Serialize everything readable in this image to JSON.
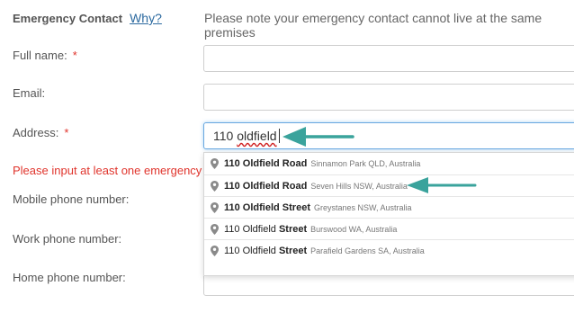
{
  "header": {
    "title": "Emergency Contact",
    "why_link": "Why?",
    "note": "Please note your emergency contact cannot live at the same premises"
  },
  "fields": {
    "full_name": {
      "label": "Full name:",
      "required": "*"
    },
    "email": {
      "label": "Email:"
    },
    "address": {
      "label": "Address:",
      "required": "*",
      "value_plain": "110 ",
      "value_spell": "oldfield"
    },
    "error": "Please input at least one emergency c",
    "mobile": {
      "label": "Mobile phone number:"
    },
    "work": {
      "label": "Work phone number:"
    },
    "home": {
      "label": "Home phone number:"
    }
  },
  "suggestions": [
    {
      "bold": "110 Oldfield",
      "rest": " Road",
      "secondary": "Sinnamon Park QLD, Australia"
    },
    {
      "bold": "110 Oldfield",
      "rest": " Road",
      "secondary": "Seven Hills NSW, Australia"
    },
    {
      "bold": "110 Oldfield",
      "rest": " Street",
      "secondary": "Greystanes NSW, Australia"
    },
    {
      "bold": "110 Oldfield",
      "rest": " Street",
      "secondary": "Burswood WA, Australia"
    },
    {
      "bold": "110 Oldfield",
      "rest": " Street",
      "secondary": "Parafield Gardens SA, Australia"
    }
  ],
  "colors": {
    "annotation_arrow": "#3aa39c",
    "error": "#e0342c",
    "link": "#2c6aa0",
    "pin_icon": "#8a8a8a"
  },
  "icons": {
    "suggestion": "map-pin-icon",
    "annotation": "arrow-left-icon"
  }
}
